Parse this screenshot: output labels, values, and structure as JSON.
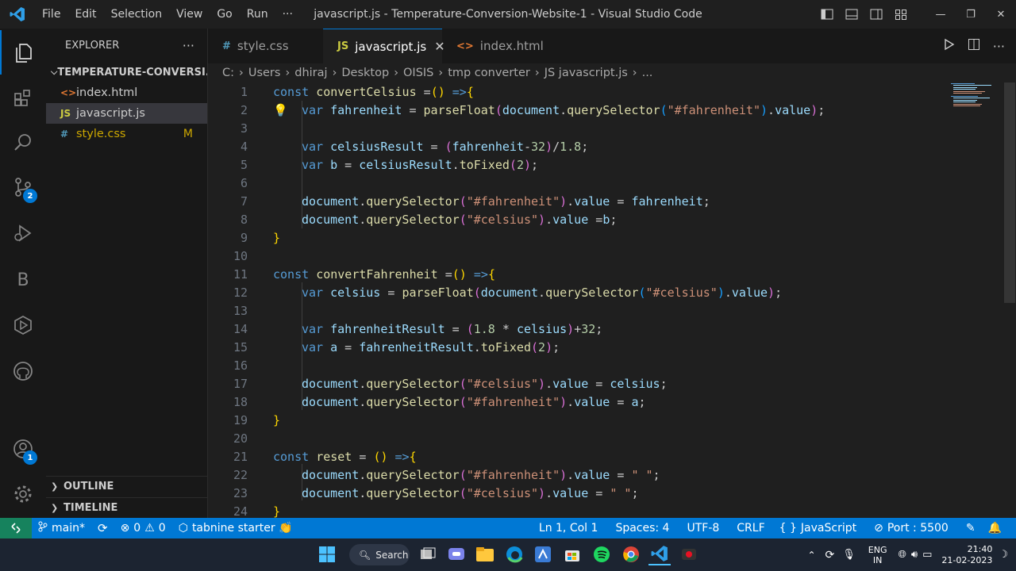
{
  "titlebar": {
    "menu": [
      "File",
      "Edit",
      "Selection",
      "View",
      "Go",
      "Run",
      "···"
    ],
    "title": "javascript.js - Temperature-Conversion-Website-1 - Visual Studio Code"
  },
  "activity": {
    "scm_badge": "2",
    "accounts_badge": "1"
  },
  "sidebar": {
    "header": "EXPLORER",
    "more": "···",
    "folder": "TEMPERATURE-CONVERSI...",
    "files": [
      {
        "icon": "<>",
        "name": "index.html",
        "color": "#e37933"
      },
      {
        "icon": "JS",
        "name": "javascript.js",
        "color": "#cbcb41"
      },
      {
        "icon": "#",
        "name": "style.css",
        "color": "#519aba"
      }
    ],
    "modified_marker": "M",
    "outline": "OUTLINE",
    "timeline": "TIMELINE"
  },
  "tabs": [
    {
      "icon": "#",
      "label": "style.css"
    },
    {
      "icon": "JS",
      "label": "javascript.js",
      "close": "✕"
    },
    {
      "icon": "<>",
      "label": "index.html"
    }
  ],
  "breadcrumb": [
    "C:",
    "Users",
    "dhiraj",
    "Desktop",
    "OISIS",
    "tmp converter",
    "JS javascript.js",
    "..."
  ],
  "editor": {
    "line_numbers": [
      "1",
      "2",
      "3",
      "4",
      "5",
      "6",
      "7",
      "8",
      "9",
      "10",
      "11",
      "12",
      "13",
      "14",
      "15",
      "16",
      "17",
      "18",
      "19",
      "20",
      "21",
      "22",
      "23",
      "24"
    ]
  },
  "statusbar": {
    "branch": "main*",
    "errors": "0",
    "warnings": "0",
    "tabnine": "tabnine starter 👏",
    "position": "Ln 1, Col 1",
    "spaces": "Spaces: 4",
    "encoding": "UTF-8",
    "eol": "CRLF",
    "language": "JavaScript",
    "port": "Port : 5500"
  },
  "taskbar": {
    "search": "Search",
    "lang_top": "ENG",
    "lang_bottom": "IN",
    "time": "21:40",
    "date": "21-02-2023"
  }
}
